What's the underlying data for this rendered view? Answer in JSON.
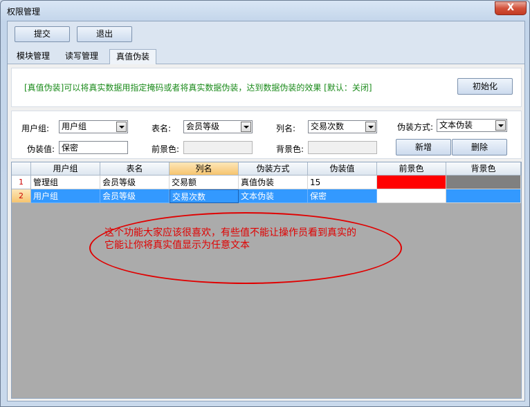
{
  "window": {
    "title": "权限管理",
    "close_label": "X"
  },
  "toolbar": {
    "submit_label": "提交",
    "exit_label": "退出"
  },
  "tabs": [
    {
      "label": "模块管理"
    },
    {
      "label": "读写管理"
    },
    {
      "label": "真值伪装"
    }
  ],
  "info": {
    "description": "[真值伪装]可以将真实数据用指定掩码或者将真实数据伪装，达到数据伪装的效果  [默认：关闭]",
    "init_label": "初始化"
  },
  "form": {
    "user_group_label": "用户组:",
    "user_group_value": "用户组",
    "table_label": "表名:",
    "table_value": "会员等级",
    "column_label": "列名:",
    "column_value": "交易次数",
    "mask_type_label": "伪装方式:",
    "mask_type_value": "文本伪装",
    "mask_value_label": "伪装值:",
    "mask_value": "保密",
    "fg_label": "前景色:",
    "bg_label": "背景色:",
    "add_label": "新增",
    "delete_label": "删除"
  },
  "grid": {
    "columns": [
      "用户组",
      "表名",
      "列名",
      "伪装方式",
      "伪装值",
      "前景色",
      "背景色"
    ],
    "rows": [
      {
        "num": "1",
        "cells": [
          "管理组",
          "会员等级",
          "交易额",
          "真值伪装",
          "15",
          "",
          ""
        ],
        "fg_color": "#ff0000",
        "bg_color": "#808080"
      },
      {
        "num": "2",
        "cells": [
          "用户组",
          "会员等级",
          "交易次数",
          "文本伪装",
          "保密",
          "",
          ""
        ],
        "fg_color": "#ffffff",
        "bg_color": "#3399ff"
      }
    ]
  },
  "annotation": {
    "line1": "这个功能大家应该很喜欢，有些值不能让操作员看到真实的",
    "line2": "它能让你将真实值显示为任意文本"
  },
  "colors": {
    "selection": "#3399ff",
    "annotation": "#e00000",
    "description": "#1a8a1a"
  }
}
